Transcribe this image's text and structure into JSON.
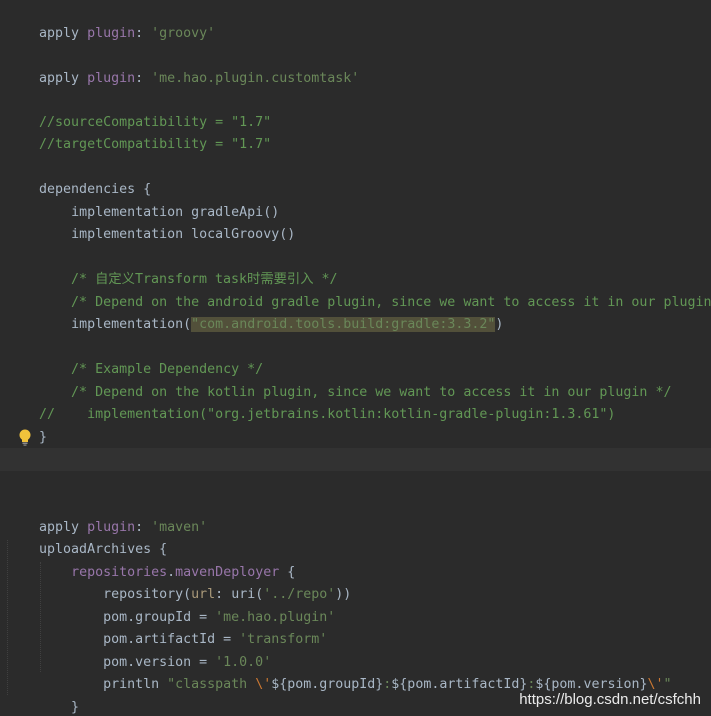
{
  "code": {
    "l1": {
      "apply": "apply",
      "plugin": "plugin",
      "colon": ": ",
      "value": "'groovy'"
    },
    "l2": {
      "apply": "apply",
      "plugin": "plugin",
      "colon": ": ",
      "value": "'me.hao.plugin.customtask'"
    },
    "l3": "//sourceCompatibility = \"1.7\"",
    "l4": "//targetCompatibility = \"1.7\"",
    "l5": {
      "name": "dependencies",
      "brace": " {"
    },
    "l6": {
      "indent": "    ",
      "call": "implementation gradleApi()"
    },
    "l7": {
      "indent": "    ",
      "call": "implementation localGroovy()"
    },
    "l8": "    /* 自定义Transform task时需要引入 */",
    "l9": "    /* Depend on the android gradle plugin, since we want to access it in our plugin */",
    "l10": {
      "indent": "    ",
      "call": "implementation(",
      "value": "\"com.android.tools.build:gradle:3.3.2\"",
      "close": ")"
    },
    "l11": "    /* Example Dependency */",
    "l12": "    /* Depend on the kotlin plugin, since we want to access it in our plugin */",
    "l13": "//    implementation(\"org.jetbrains.kotlin:kotlin-gradle-plugin:1.3.61\")",
    "l14": "}",
    "l15": {
      "apply": "apply",
      "plugin": "plugin",
      "colon": ": ",
      "value": "'maven'"
    },
    "l16": {
      "name": "uploadArchives",
      "brace": " {"
    },
    "l17": {
      "indent": "    ",
      "repos": "repositories",
      "dot": ".",
      "deployer": "mavenDeployer",
      "brace": " {"
    },
    "l18": {
      "indent": "        ",
      "call": "repository(",
      "param": "url",
      "colon": ": ",
      "uri": "uri(",
      "value": "'../repo'",
      "close": "))"
    },
    "l19": {
      "indent": "        ",
      "prop": "pom.groupId = ",
      "value": "'me.hao.plugin'"
    },
    "l20": {
      "indent": "        ",
      "prop": "pom.artifactId = ",
      "value": "'transform'"
    },
    "l21": {
      "indent": "        ",
      "prop": "pom.version = ",
      "value": "'1.0.0'"
    },
    "l22": {
      "indent": "        ",
      "call": "println ",
      "q1": "\"classpath ",
      "esc1": "\\'",
      "i1": "${pom.groupId}",
      "sep1": ":",
      "i2": "${pom.artifactId}",
      "sep2": ":",
      "i3": "${pom.version}",
      "esc2": "\\'",
      "q2": "\""
    },
    "l23": "    }",
    "l24": "}"
  },
  "intention_icon": "lightbulb-icon",
  "watermark": "https://blog.csdn.net/csfchh",
  "colors": {
    "background": "#2b2b2b",
    "current_line": "#323232",
    "keyword": "#cc7832",
    "string": "#6a8759",
    "comment": "#629755",
    "text": "#a9b7c6",
    "property": "#9876aa",
    "bulb": "#f0c23b"
  }
}
